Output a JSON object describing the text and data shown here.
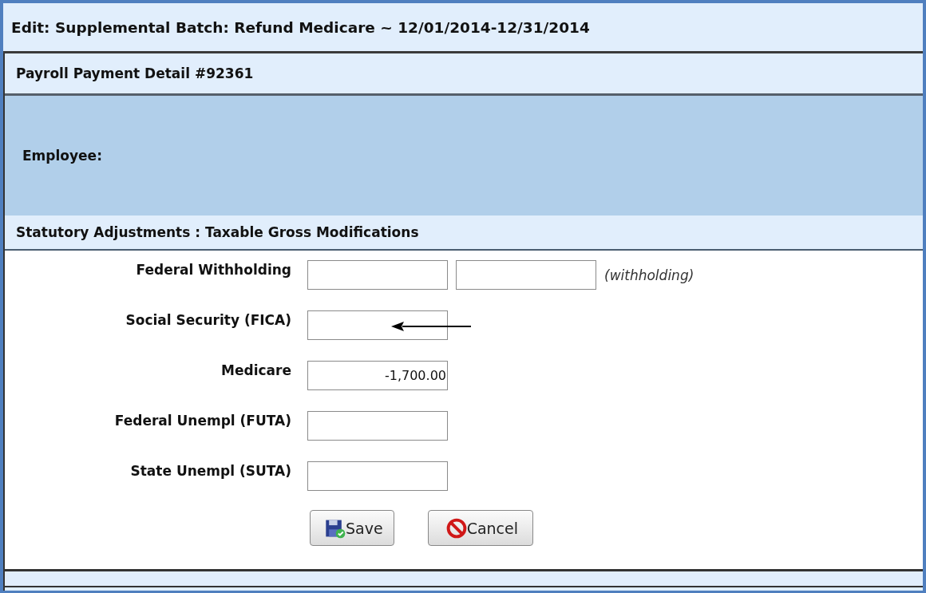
{
  "window": {
    "title": "Edit: Supplemental Batch: Refund Medicare ~ 12/01/2014-12/31/2014"
  },
  "panel": {
    "title": "Payroll Payment Detail #92361"
  },
  "employee": {
    "label": "Employee:"
  },
  "section": {
    "title": "Statutory Adjustments : Taxable Gross Modifications"
  },
  "fields": [
    {
      "label": "Federal Withholding",
      "inputs": [
        {
          "kind": "amount"
        },
        {
          "kind": "amount"
        }
      ],
      "note": "(withholding)"
    },
    {
      "label": "Social Security (FICA)",
      "inputs": [
        {
          "kind": "amount"
        }
      ],
      "annotated": true
    },
    {
      "label": "Medicare",
      "inputs": [
        {
          "kind": "amount",
          "value": "-1,700.00"
        }
      ]
    },
    {
      "label": "Federal Unempl (FUTA)",
      "inputs": [
        {
          "kind": "amount"
        }
      ]
    },
    {
      "label": "State Unempl (SUTA)",
      "inputs": [
        {
          "kind": "amount"
        }
      ]
    }
  ],
  "buttons": [
    {
      "kind": "save",
      "label": "Save"
    },
    {
      "kind": "cancel",
      "label": "Cancel"
    }
  ]
}
